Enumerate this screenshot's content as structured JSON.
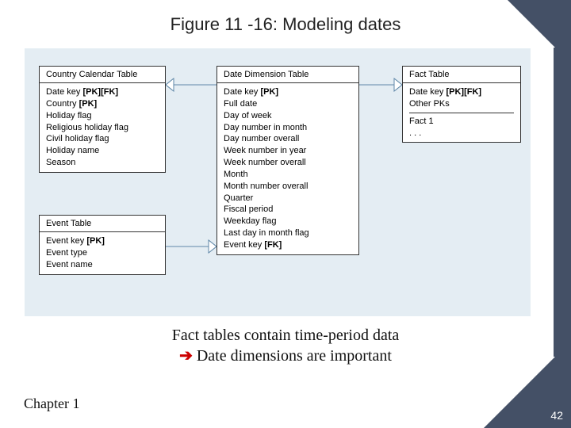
{
  "title": "Figure 11 -16: Modeling dates",
  "tables": {
    "cct": {
      "name": "Country Calendar Table",
      "rows": [
        "Date key [PK][FK]",
        "Country [PK]",
        "Holiday flag",
        "Religious holiday flag",
        "Civil holiday flag",
        "Holiday name",
        "Season"
      ]
    },
    "evt": {
      "name": "Event Table",
      "rows": [
        "Event key [PK]",
        "Event type",
        "Event name"
      ]
    },
    "ddt": {
      "name": "Date Dimension Table",
      "rows": [
        "Date key [PK]",
        "Full date",
        "Day of week",
        "Day number in month",
        "Day number overall",
        "Week number in year",
        "Week number overall",
        "Month",
        "Month number overall",
        "Quarter",
        "Fiscal period",
        "Weekday flag",
        "Last day in month flag",
        "Event key [FK]"
      ]
    },
    "fact": {
      "name": "Fact Table",
      "top_rows": [
        "Date key [PK][FK]",
        "Other PKs"
      ],
      "bottom_rows": [
        "Fact 1",
        ". . ."
      ]
    }
  },
  "caption": {
    "line1": "Fact tables contain time-period data",
    "line2_arrow": "➔",
    "line2_text": " Date dimensions are important"
  },
  "footer": {
    "chapter": "Chapter 1",
    "page": "42"
  },
  "chart_data": {
    "type": "table",
    "description": "Entity-relationship diagram of four tables for modeling dates in a dimensional model",
    "entities": [
      {
        "name": "Country Calendar Table",
        "attributes": [
          "Date key [PK][FK]",
          "Country [PK]",
          "Holiday flag",
          "Religious holiday flag",
          "Civil holiday flag",
          "Holiday name",
          "Season"
        ]
      },
      {
        "name": "Event Table",
        "attributes": [
          "Event key [PK]",
          "Event type",
          "Event name"
        ]
      },
      {
        "name": "Date Dimension Table",
        "attributes": [
          "Date key [PK]",
          "Full date",
          "Day of week",
          "Day number in month",
          "Day number overall",
          "Week number in year",
          "Week number overall",
          "Month",
          "Month number overall",
          "Quarter",
          "Fiscal period",
          "Weekday flag",
          "Last day in month flag",
          "Event key [FK]"
        ]
      },
      {
        "name": "Fact Table",
        "attributes": [
          "Date key [PK][FK]",
          "Other PKs",
          "Fact 1",
          "..."
        ]
      }
    ],
    "relationships": [
      {
        "from": "Date Dimension Table",
        "to": "Country Calendar Table",
        "via": "Date key"
      },
      {
        "from": "Date Dimension Table",
        "to": "Fact Table",
        "via": "Date key"
      },
      {
        "from": "Event Table",
        "to": "Date Dimension Table",
        "via": "Event key"
      }
    ]
  }
}
